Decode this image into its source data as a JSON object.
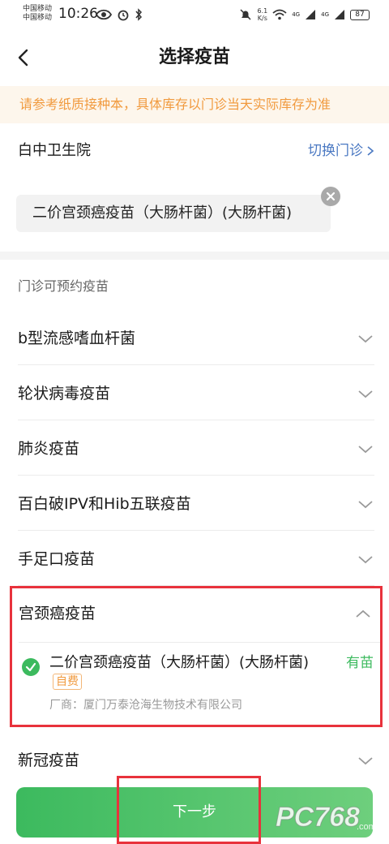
{
  "status_bar": {
    "carrier_1": "中国移动",
    "carrier_2": "中国移动",
    "time": "10:26",
    "network_speed_value": "6.1",
    "network_speed_unit": "K/s",
    "signal_tag_1": "4G",
    "signal_tag_2": "4G",
    "battery": "87"
  },
  "header": {
    "title": "选择疫苗"
  },
  "notice": "请参考纸质接种本，具体库存以门诊当天实际库存为准",
  "clinic": {
    "name": "白中卫生院",
    "switch_label": "切换门诊"
  },
  "selected_tag": "二价宫颈癌疫苗（大肠杆菌）(大肠杆菌)",
  "vaccines": {
    "section_label": "门诊可预约疫苗",
    "categories": [
      {
        "label": "b型流感嗜血杆菌"
      },
      {
        "label": "轮状病毒疫苗"
      },
      {
        "label": "肺炎疫苗"
      },
      {
        "label": "百白破IPV和Hib五联疫苗"
      },
      {
        "label": "手足口疫苗"
      }
    ],
    "expanded": {
      "label": "宫颈癌疫苗",
      "item_name": "二价宫颈癌疫苗（大肠杆菌）(大肠杆菌)",
      "item_badge": "自费",
      "stock": "有苗",
      "manufacturer": "厂商：厦门万泰沧海生物技术有限公司"
    },
    "after": [
      {
        "label": "新冠疫苗"
      }
    ]
  },
  "footer": {
    "next_label": "下一步"
  },
  "watermark": {
    "logo": "PC768",
    "suffix": ".com"
  },
  "colors": {
    "accent_green": "#3cba5e",
    "notice_orange": "#f19a3e",
    "link_blue": "#4a78c2",
    "highlight_red": "#e8323c"
  }
}
